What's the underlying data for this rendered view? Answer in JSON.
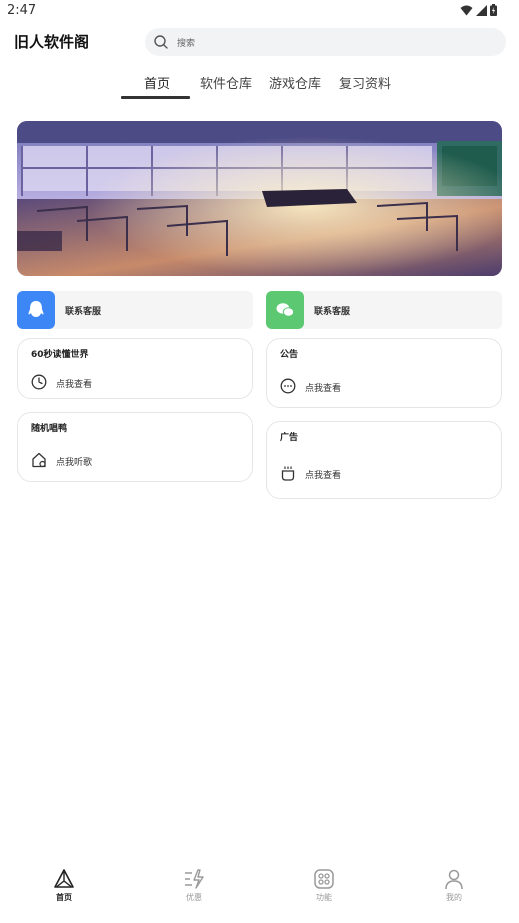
{
  "status_bar": {
    "time": "2:47"
  },
  "header": {
    "title": "旧人软件阁",
    "search_placeholder": "搜索"
  },
  "tabs": [
    {
      "label": "首页",
      "active": true
    },
    {
      "label": "软件仓库",
      "active": false
    },
    {
      "label": "游戏仓库",
      "active": false
    },
    {
      "label": "复习资料",
      "active": false
    }
  ],
  "contacts": [
    {
      "label": "联系客服",
      "icon": "qq-icon",
      "color": "#3d86f6"
    },
    {
      "label": "联系客服",
      "icon": "wechat-icon",
      "color": "#5cc872"
    }
  ],
  "features": [
    {
      "title": "60秒读懂世界",
      "action": "点我查看",
      "icon": "clock-icon"
    },
    {
      "title": "公告",
      "action": "点我查看",
      "icon": "more-icon"
    },
    {
      "title": "随机唱鸭",
      "action": "点我听歌",
      "icon": "music-home-icon"
    },
    {
      "title": "广告",
      "action": "点我查看",
      "icon": "cup-icon"
    }
  ],
  "bottom_nav": [
    {
      "label": "首页",
      "icon": "home-icon",
      "active": true
    },
    {
      "label": "优惠",
      "icon": "discount-icon",
      "active": false
    },
    {
      "label": "功能",
      "icon": "features-icon",
      "active": false
    },
    {
      "label": "我的",
      "icon": "profile-icon",
      "active": false
    }
  ]
}
